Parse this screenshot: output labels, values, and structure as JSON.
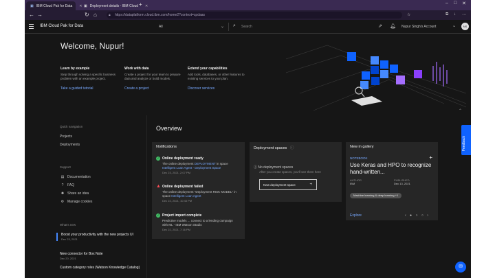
{
  "browser": {
    "tabs": [
      {
        "label": "IBM Cloud Pak for Data"
      },
      {
        "label": "Deployment details - IBM Cloud"
      }
    ],
    "new_tab": "+",
    "url": "https://dataplatform.cloud.ibm.com/home2?context=cpdaas"
  },
  "header": {
    "brand": "IBM Cloud Pak for Data",
    "scope_select": "All",
    "search_placeholder": "Search",
    "account": "Nupur Singh's Account",
    "avatar": "NS"
  },
  "welcome": {
    "title": "Welcome, Nupur!",
    "columns": [
      {
        "heading": "Learn by example",
        "text": "Step through solving a specific business problem with an example project.",
        "link": "Take a guided tutorial"
      },
      {
        "heading": "Work with data",
        "text": "Create a project for your team to prepare data and analyze or build models.",
        "link": "Create a project"
      },
      {
        "heading": "Extend your capabilities",
        "text": "Add tools, databases, or other features to existing services to your plan.",
        "link": "Discover services"
      }
    ]
  },
  "left": {
    "quick_nav_heading": "Quick navigation",
    "quick_nav": [
      "Projects",
      "Deployments"
    ],
    "support_heading": "Support",
    "support": [
      {
        "label": "Documentation",
        "icon": "document-icon"
      },
      {
        "label": "FAQ",
        "icon": "help-icon"
      },
      {
        "label": "Share an idea",
        "icon": "lightbulb-icon"
      },
      {
        "label": "Manage cookies",
        "icon": "settings-icon"
      }
    ],
    "whats_new_heading": "What's new",
    "news": [
      {
        "title": "Boost your productivity with the new projects UI",
        "date": "Dec 23, 2021"
      },
      {
        "title": "New connector for Box Note",
        "date": "Dec 20, 2021"
      },
      {
        "title": "Custom category roles (Watson Knowledge Catalog)",
        "date": ""
      }
    ]
  },
  "overview": {
    "title": "Overview",
    "notifications": {
      "heading": "Notifications",
      "items": [
        {
          "status": "success",
          "title": "Online deployment ready",
          "body_pre": "The online deployment ",
          "body_link1": "DEPLOYMENT",
          "body_mid": " in space ",
          "body_link2": "Intelligent Loan Agent - Deployment Space",
          "date": "Dec 23, 2021, 2:07 PM"
        },
        {
          "status": "error",
          "title": "Online deployment failed",
          "body_pre": "The online deployment \"Deployment RISK MODEL\" in space ",
          "body_link1": "",
          "body_mid": "",
          "body_link2": "Intelligent Loan Agent",
          "date": "Dec 22, 2021, 10:43 PM"
        },
        {
          "status": "success",
          "title": "Project import complete",
          "body_pre": "Predictive models ... connect to a lending campaign with ML - IBM Watson Studio",
          "body_link1": "",
          "body_mid": "",
          "body_link2": "",
          "date": "Dec 22, 2021, 7:16 PM"
        }
      ]
    },
    "deployment": {
      "heading": "Deployment spaces",
      "message": "No deployment spaces",
      "sub": "After you create spaces, you'll see them here",
      "button": "New deployment space",
      "button_icon": "+"
    },
    "gallery": {
      "heading": "New in gallery",
      "type": "NOTEBOOK",
      "title": "Use Keras and HPO to recognize hand-written...",
      "author_label": "AUTHOR",
      "author": "IBM",
      "published_label": "PUBLISHED",
      "published": "Dec 13, 2021",
      "tag": "Machine learning & deep learning +1",
      "explore": "Explore",
      "pager": "‹ ● ○ ○ ›"
    }
  },
  "feedback": "Feedback",
  "colors": {
    "accent": "#0f62fe",
    "link": "#78a9ff",
    "success": "#42be65",
    "error": "#fa4d56",
    "browser_chrome": "#3a2a52"
  }
}
